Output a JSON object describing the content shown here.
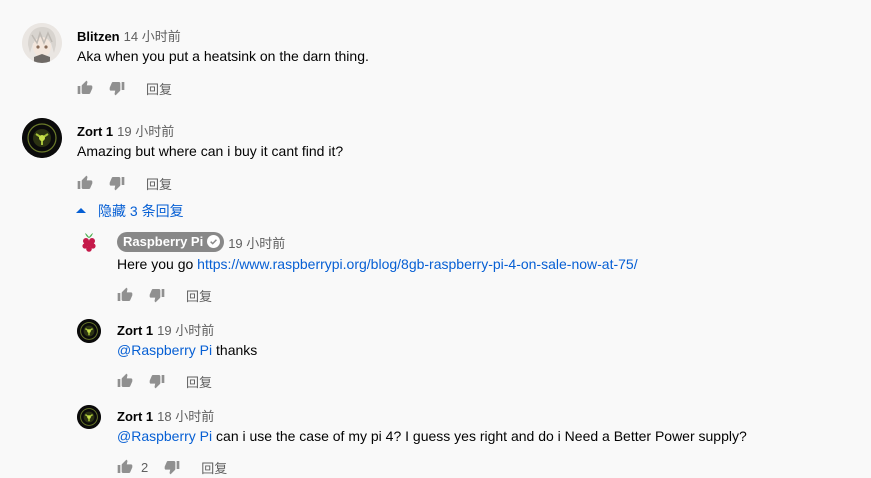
{
  "comments": [
    {
      "author": "Blitzen",
      "time": "14 小时前",
      "text": "Aka when you put a heatsink on the darn thing.",
      "reply_label": "回复"
    },
    {
      "author": "Zort 1",
      "time": "19 小时前",
      "text": "Amazing but where can i buy it cant find it?",
      "reply_label": "回复"
    }
  ],
  "hide_replies_label": "隐藏 3 条回复",
  "replies": [
    {
      "author": "Raspberry Pi",
      "time": "19 小时前",
      "text_prefix": "Here you go ",
      "link": "https://www.raspberrypi.org/blog/8gb-raspberry-pi-4-on-sale-now-at-75/",
      "reply_label": "回复"
    },
    {
      "author": "Zort 1",
      "time": "19 小时前",
      "mention": "@Raspberry Pi",
      "text": " thanks",
      "reply_label": "回复"
    },
    {
      "author": "Zort 1",
      "time": "18 小时前",
      "mention": "@Raspberry Pi",
      "text": " can i use the case of my pi 4? I guess yes right and do i Need a Better Power supply?",
      "like_count": "2",
      "reply_label": "回复"
    }
  ],
  "colors": {
    "link": "#065fd4",
    "badge": "#888888",
    "secondary_text": "#606060",
    "icon": "#909090"
  }
}
